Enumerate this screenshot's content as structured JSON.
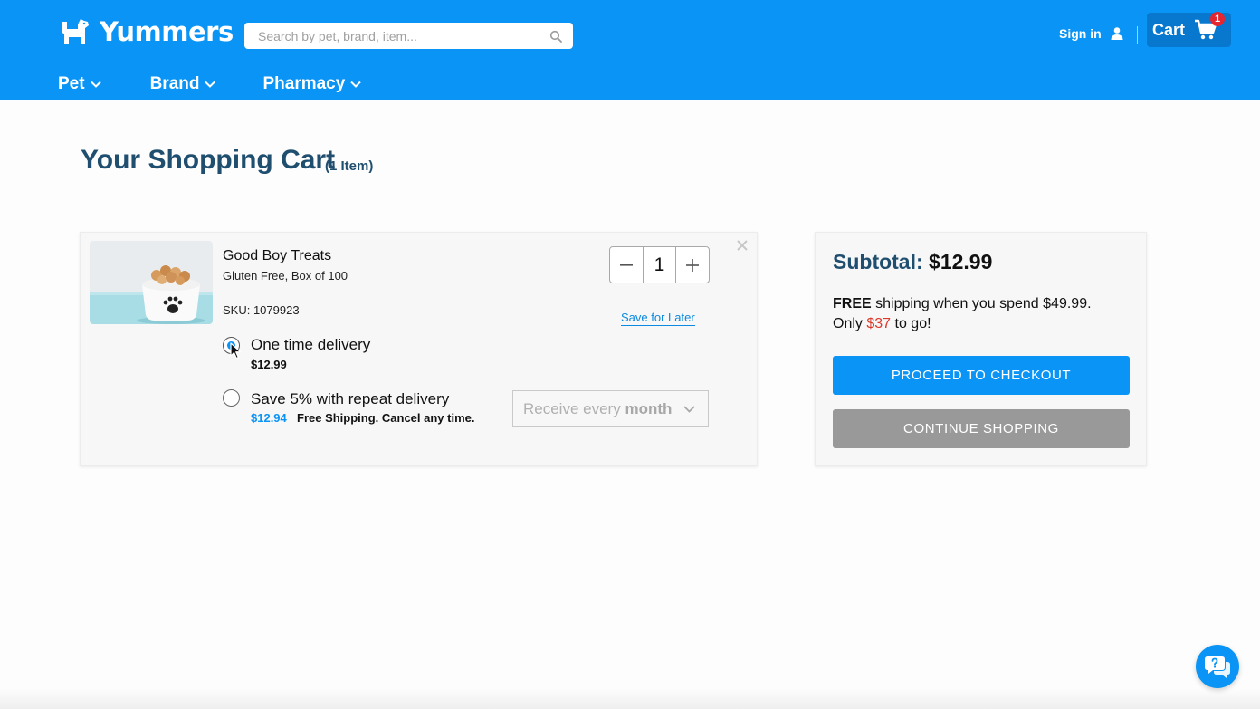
{
  "header": {
    "brand": "Yummers",
    "search_placeholder": "Search by pet, brand, item...",
    "signin_label": "Sign in",
    "cart_label": "Cart",
    "cart_count": "1"
  },
  "nav": {
    "items": [
      {
        "label": "Pet"
      },
      {
        "label": "Brand"
      },
      {
        "label": "Pharmacy"
      }
    ]
  },
  "page": {
    "title": "Your Shopping Cart",
    "item_count": "(1 Item)"
  },
  "cart_item": {
    "name": "Good Boy Treats",
    "variant": "Gluten Free, Box of 100",
    "sku": "SKU: 1079923",
    "quantity": "1",
    "save_for_later": "Save for Later",
    "options": [
      {
        "label": "One time delivery",
        "price": "$12.99",
        "selected": true
      },
      {
        "label": "Save 5% with repeat delivery",
        "price": "$12.94",
        "note": "Free Shipping. Cancel any time.",
        "selected": false
      }
    ],
    "frequency": {
      "prefix": "Receive every",
      "value": "month"
    }
  },
  "summary": {
    "subtotal_label": "Subtotal:",
    "subtotal_value": "$12.99",
    "free_word": "FREE",
    "shipping_text": "shipping when you spend $49.99.",
    "only_word": "Only",
    "remaining": "$37",
    "to_go": "to go!",
    "checkout_label": "PROCEED TO CHECKOUT",
    "continue_label": "CONTINUE SHOPPING"
  },
  "colors": {
    "header_blue": "#0a94f5",
    "cart_button": "#0878cf",
    "title_navy": "#1f4e6f",
    "badge_red": "#e3262f",
    "remaining_red": "#d93a2b",
    "continue_gray": "#999999"
  },
  "icons": {
    "logo": "dog-icon",
    "search": "search-icon",
    "user": "user-icon",
    "cart": "cart-icon",
    "remove": "close-icon",
    "chat": "chat-help-icon"
  }
}
